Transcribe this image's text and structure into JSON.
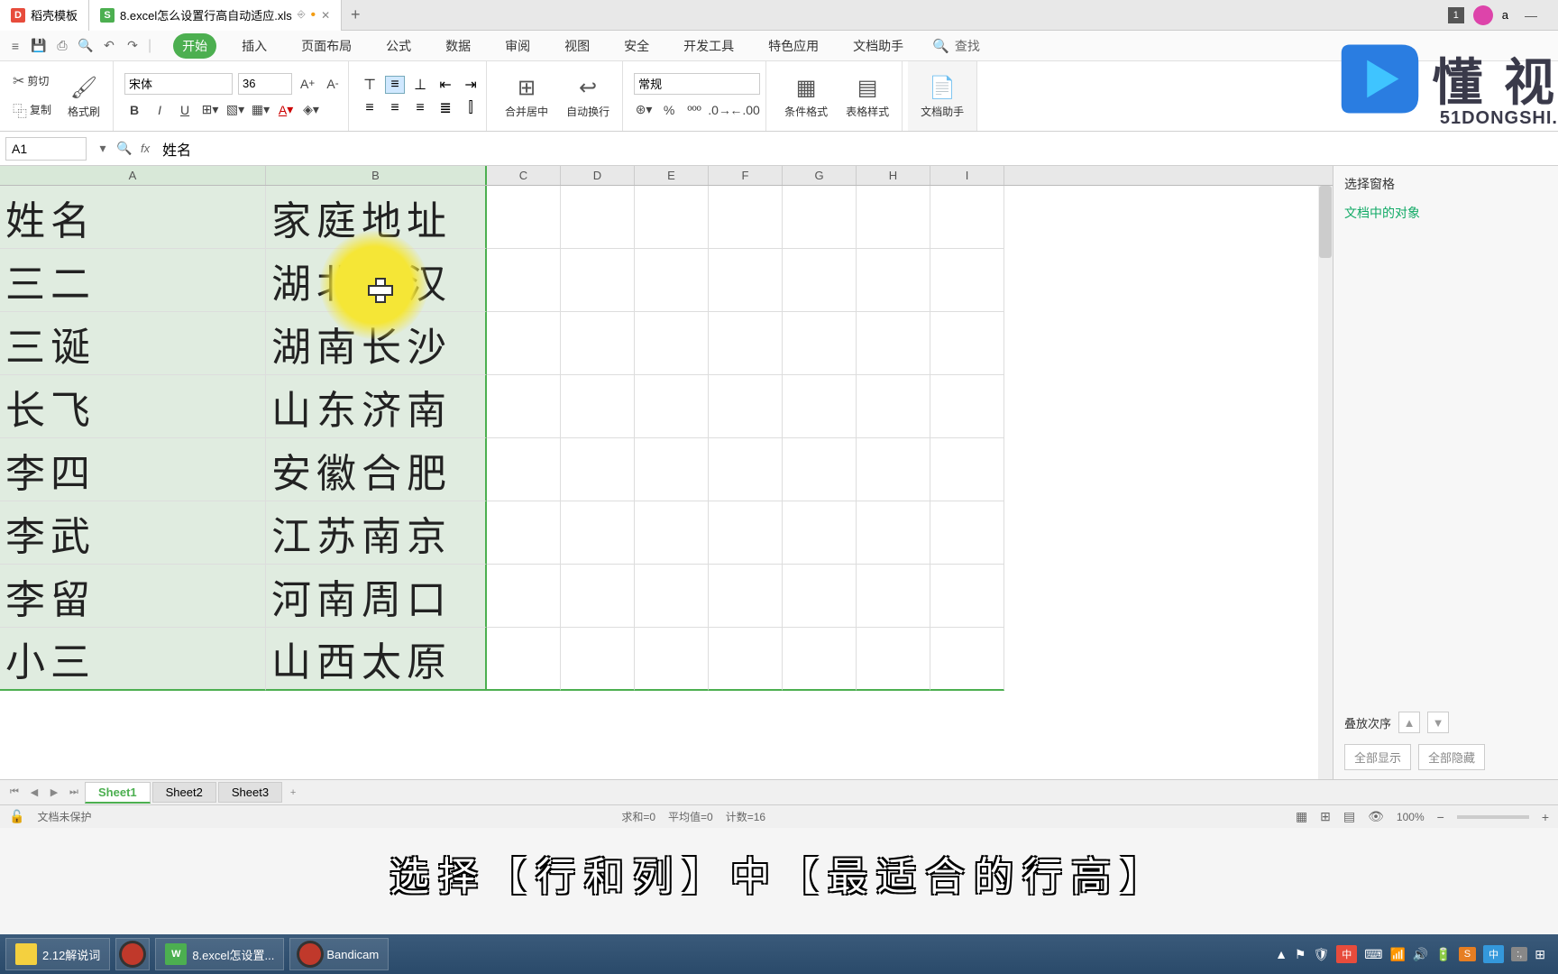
{
  "titleTabs": {
    "t1": {
      "icon": "D",
      "label": "稻壳模板"
    },
    "t2": {
      "icon": "S",
      "label": "8.excel怎么设置行高自动适应.xls",
      "suffix": "⎆",
      "dirty": "•"
    }
  },
  "titleRight": {
    "badge": "1",
    "name": "a"
  },
  "menuTabs": [
    "开始",
    "插入",
    "页面布局",
    "公式",
    "数据",
    "审阅",
    "视图",
    "安全",
    "开发工具",
    "特色应用",
    "文档助手"
  ],
  "menuActiveIndex": 0,
  "search": {
    "icon": "🔍",
    "label": "查找"
  },
  "ribbon": {
    "cut": "剪切",
    "copy": "复制",
    "painter": "格式刷",
    "fontName": "宋体",
    "fontSize": "36",
    "merge": "合并居中",
    "wrap": "自动换行",
    "numberFormat": "常规",
    "condFmt": "条件格式",
    "tableStyle": "表格样式",
    "docHelper": "文档助手"
  },
  "formulaBar": {
    "cellRef": "A1",
    "value": "姓名"
  },
  "columns": [
    "A",
    "B",
    "C",
    "D",
    "E",
    "F",
    "G",
    "H",
    "I"
  ],
  "chart_data": {
    "type": "table",
    "headers": [
      "姓名",
      "家庭地址"
    ],
    "rows": [
      [
        "姓名",
        "家庭地址"
      ],
      [
        "三二",
        "湖北武汉"
      ],
      [
        "三诞",
        "湖南长沙"
      ],
      [
        "长飞",
        "山东济南"
      ],
      [
        "李四",
        "安徽合肥"
      ],
      [
        "李武",
        "江苏南京"
      ],
      [
        "李留",
        "河南周口"
      ],
      [
        "小三",
        "山西太原"
      ]
    ]
  },
  "rightPanel": {
    "selectPane": "选择窗格",
    "objectsLabel": "文档中的对象",
    "orderLabel": "叠放次序",
    "showAll": "全部显示",
    "hideAll": "全部隐藏"
  },
  "sheetTabs": [
    "Sheet1",
    "Sheet2",
    "Sheet3"
  ],
  "activeSheet": 0,
  "statusBar": {
    "protect": "文档未保护",
    "sum": "求和=0",
    "avg": "平均值=0",
    "count": "计数=16",
    "zoom": "100%"
  },
  "watermark": {
    "text": "懂 视",
    "url": "51DONGSHI."
  },
  "subtitle": "选择【行和列】中【最适合的行高】",
  "taskbar": {
    "folder": "2.12解说词",
    "wps": "8.excel怎设置...",
    "bandicam": "Bandicam",
    "ime": "中",
    "ime2": "S",
    "ime3": ":,"
  }
}
